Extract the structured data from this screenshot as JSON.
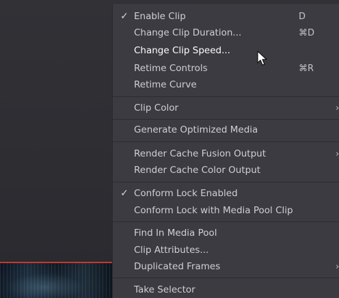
{
  "menu": {
    "items": [
      {
        "label": "Enable Clip",
        "shortcut": "D",
        "checked": "✓",
        "arrow": ""
      },
      {
        "label": "Change Clip Duration...",
        "shortcut": "⌘D",
        "checked": "",
        "arrow": ""
      },
      {
        "label": "Change Clip Speed...",
        "shortcut": "",
        "checked": "",
        "arrow": ""
      },
      {
        "label": "Retime Controls",
        "shortcut": "⌘R",
        "checked": "",
        "arrow": ""
      },
      {
        "label": "Retime Curve",
        "shortcut": "",
        "checked": "",
        "arrow": ""
      },
      {
        "label": "Clip Color",
        "shortcut": "",
        "checked": "",
        "arrow": "›"
      },
      {
        "label": "Generate Optimized Media",
        "shortcut": "",
        "checked": "",
        "arrow": ""
      },
      {
        "label": "Render Cache Fusion Output",
        "shortcut": "",
        "checked": "",
        "arrow": "›"
      },
      {
        "label": "Render Cache Color Output",
        "shortcut": "",
        "checked": "",
        "arrow": ""
      },
      {
        "label": "Conform Lock Enabled",
        "shortcut": "",
        "checked": "✓",
        "arrow": ""
      },
      {
        "label": "Conform Lock with Media Pool Clip",
        "shortcut": "",
        "checked": "",
        "arrow": ""
      },
      {
        "label": "Find In Media Pool",
        "shortcut": "",
        "checked": "",
        "arrow": ""
      },
      {
        "label": "Clip Attributes...",
        "shortcut": "",
        "checked": "",
        "arrow": ""
      },
      {
        "label": "Duplicated Frames",
        "shortcut": "",
        "checked": "",
        "arrow": "›"
      },
      {
        "label": "Take Selector",
        "shortcut": "",
        "checked": "",
        "arrow": ""
      }
    ],
    "highlight_color": "#ffffff",
    "text_color": "#cfcfd4",
    "background": "#3b3b41"
  },
  "timeline": {
    "playhead_color": "#c8382f"
  }
}
